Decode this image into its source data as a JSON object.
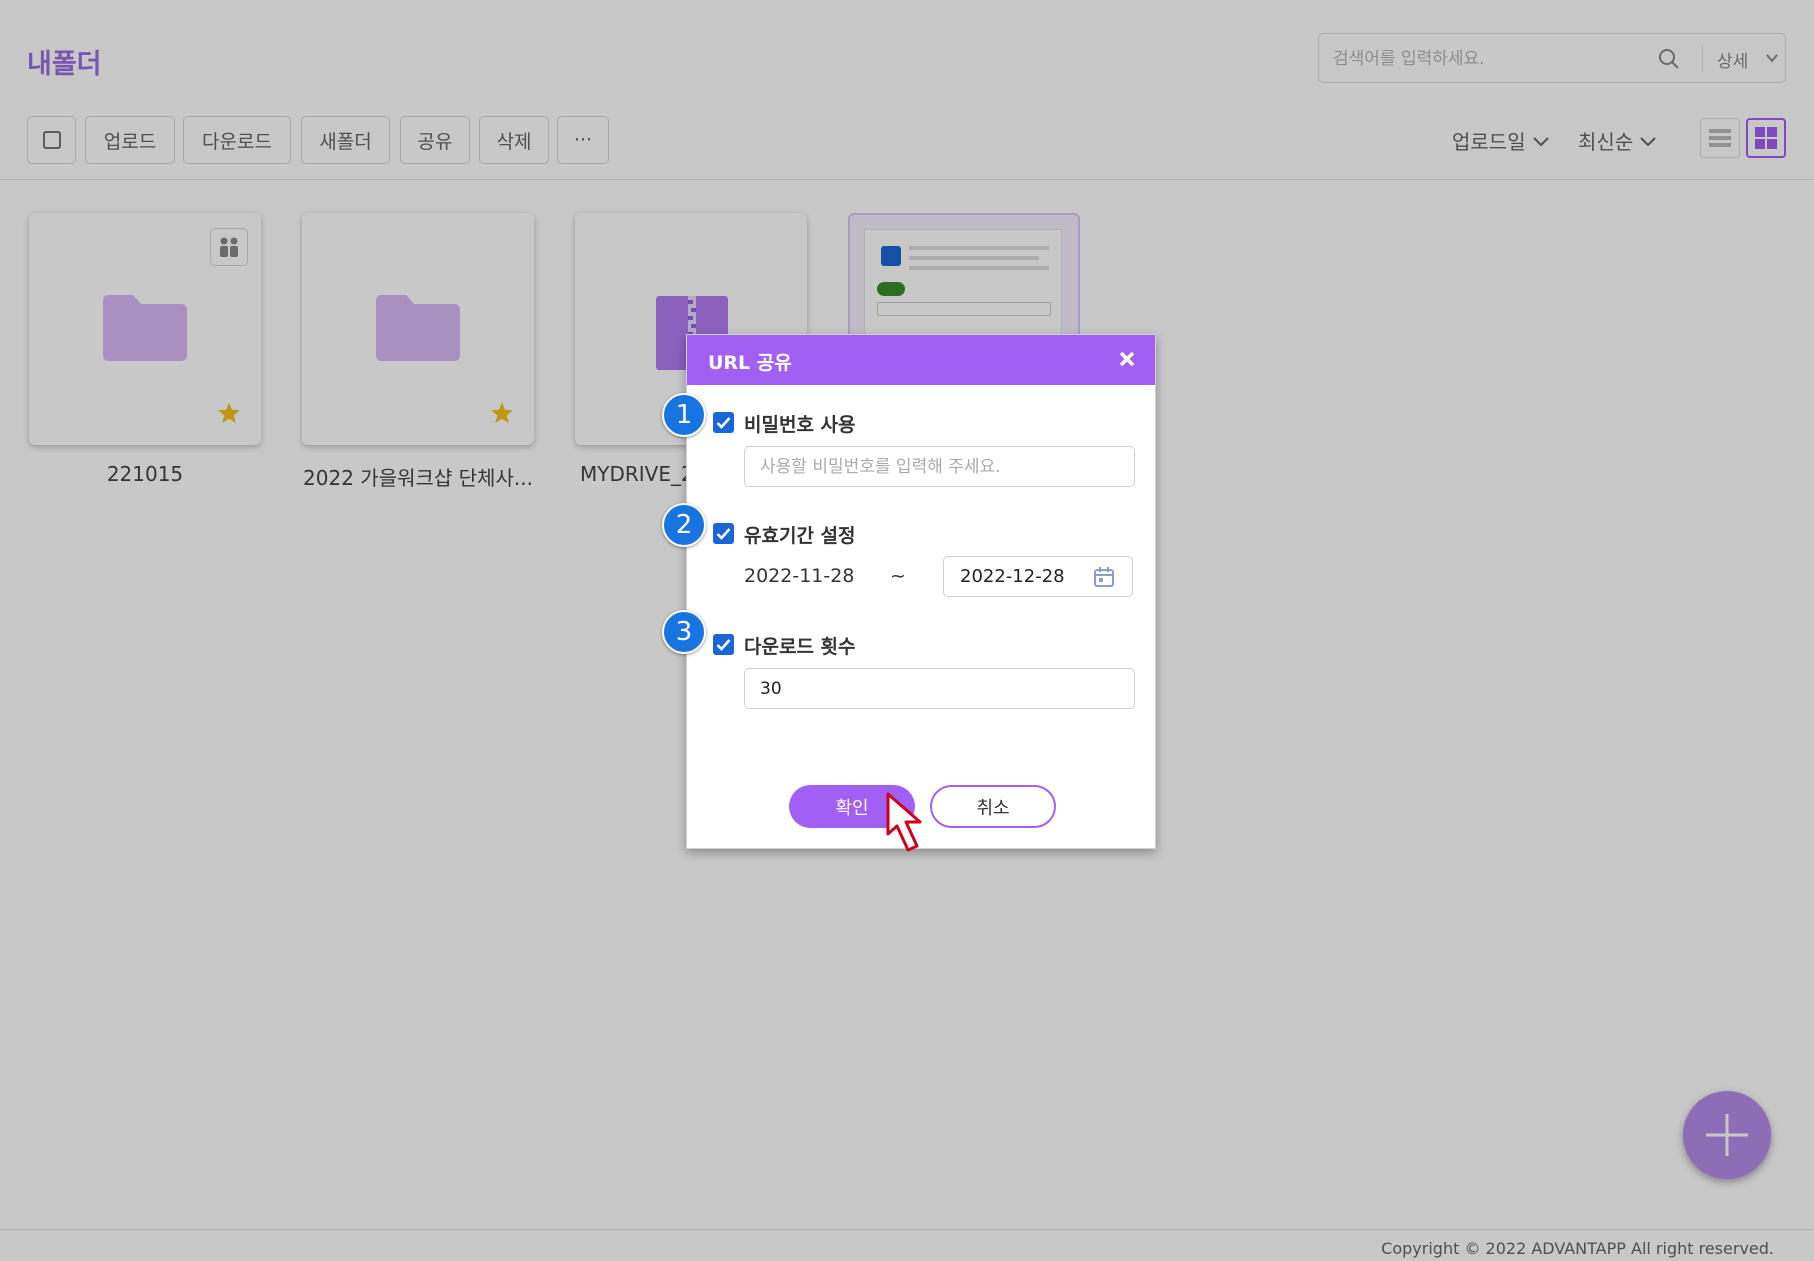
{
  "header": {
    "title": "내폴더",
    "search_placeholder": "검색어를 입력하세요.",
    "search_detail": "상세"
  },
  "toolbar": {
    "upload": "업로드",
    "download": "다운로드",
    "new_folder": "새폴더",
    "share": "공유",
    "delete": "삭제",
    "more": "···",
    "sort_field": "업로드일",
    "sort_order": "최신순"
  },
  "files": [
    {
      "name": "221015",
      "type": "folder",
      "shared": true,
      "starred": true
    },
    {
      "name": "2022 가을워크샵 단체사...",
      "type": "folder",
      "shared": false,
      "starred": true
    },
    {
      "name": "MYDRIVE_2",
      "type": "zip",
      "shared": false,
      "starred": false
    },
    {
      "name": "",
      "type": "image",
      "shared": false,
      "starred": false
    }
  ],
  "dialog": {
    "title": "URL 공유",
    "password_label": "비밀번호 사용",
    "password_checked": true,
    "password_placeholder": "사용할 비밀번호를 입력해 주세요.",
    "expiry_label": "유효기간 설정",
    "expiry_checked": true,
    "start_date": "2022-11-28",
    "tilde": "~",
    "end_date": "2022-12-28",
    "download_label": "다운로드 횟수",
    "download_checked": true,
    "download_count": "30",
    "confirm": "확인",
    "cancel": "취소"
  },
  "step_badges": [
    "1",
    "2",
    "3"
  ],
  "footer": "Copyright © 2022 ADVANTAPP All right reserved.",
  "colors": {
    "accent": "#a25ff4",
    "folder": "#d6b8f4",
    "checkbox": "#1a66d6",
    "badge": "#1774e0"
  }
}
